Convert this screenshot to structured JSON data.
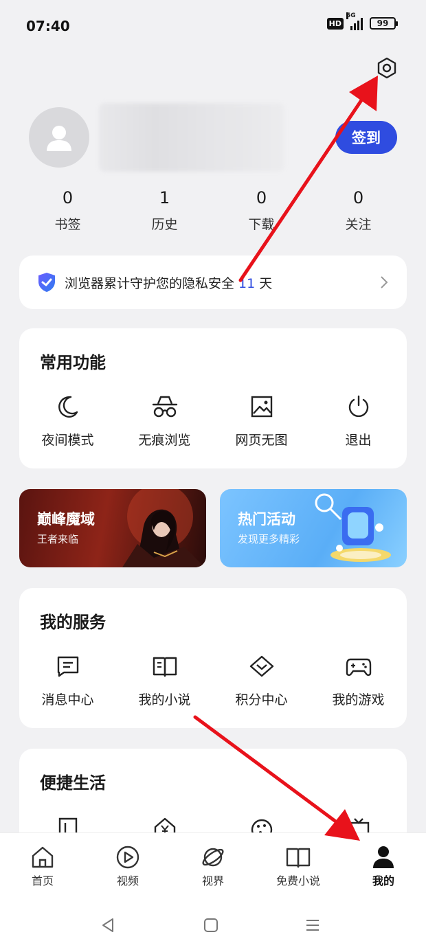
{
  "status_bar": {
    "time": "07:40",
    "hd": "HD",
    "network": "5G",
    "battery": "99"
  },
  "profile": {
    "checkin_label": "签到"
  },
  "stats": [
    {
      "value": "0",
      "label": "书签"
    },
    {
      "value": "1",
      "label": "历史"
    },
    {
      "value": "0",
      "label": "下载"
    },
    {
      "value": "0",
      "label": "关注"
    }
  ],
  "privacy": {
    "prefix": "浏览器累计守护您的隐私安全",
    "days": "11",
    "suffix": "天"
  },
  "common_features": {
    "title": "常用功能",
    "items": [
      {
        "label": "夜间模式",
        "icon": "moon-icon"
      },
      {
        "label": "无痕浏览",
        "icon": "incognito-icon"
      },
      {
        "label": "网页无图",
        "icon": "no-image-icon"
      },
      {
        "label": "退出",
        "icon": "power-icon"
      }
    ]
  },
  "banners": [
    {
      "title": "巅峰魔域",
      "subtitle": "王者来临"
    },
    {
      "title": "热门活动",
      "subtitle": "发现更多精彩"
    }
  ],
  "my_services": {
    "title": "我的服务",
    "items": [
      {
        "label": "消息中心",
        "icon": "message-icon"
      },
      {
        "label": "我的小说",
        "icon": "book-icon"
      },
      {
        "label": "积分中心",
        "icon": "diamond-icon"
      },
      {
        "label": "我的游戏",
        "icon": "gamepad-icon"
      }
    ]
  },
  "convenient_life": {
    "title": "便捷生活"
  },
  "tabbar": [
    {
      "label": "首页",
      "icon": "home-icon",
      "active": false
    },
    {
      "label": "视频",
      "icon": "play-icon",
      "active": false
    },
    {
      "label": "视界",
      "icon": "planet-icon",
      "active": false
    },
    {
      "label": "免费小说",
      "icon": "open-book-icon",
      "active": false
    },
    {
      "label": "我的",
      "icon": "person-icon",
      "active": true
    }
  ],
  "colors": {
    "accent": "#2f4ce0",
    "annotation_arrow": "#e8121b",
    "background": "#f1f1f3"
  }
}
